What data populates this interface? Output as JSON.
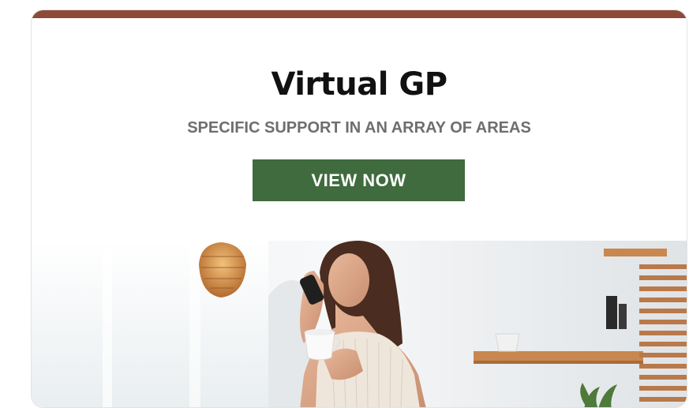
{
  "card": {
    "title": "Virtual GP",
    "subtitle": "SPECIFIC SUPPORT IN AN ARRAY OF AREAS",
    "button_label": "VIEW NOW"
  },
  "colors": {
    "accent_bar": "#8e4a38",
    "button_bg": "#3f6b3e",
    "subtitle_text": "#6e6e6e"
  },
  "image": {
    "name": "woman-on-phone-with-coffee-photo"
  }
}
